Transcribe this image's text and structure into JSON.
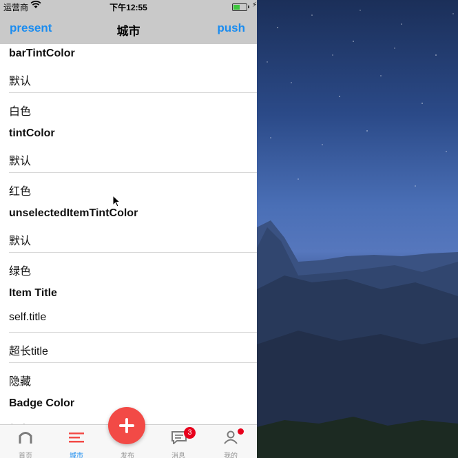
{
  "status_bar": {
    "carrier": "运营商",
    "time": "下午12:55"
  },
  "nav": {
    "left": "present",
    "title": "城市",
    "right": "push"
  },
  "list": {
    "rows": [
      "barTintColor",
      "默认",
      "白色",
      "tintColor",
      "默认",
      "红色",
      "unselectedItemTintColor",
      "默认",
      "绿色",
      "Item Title",
      "self.title",
      "超长title",
      "隐藏",
      "Badge Color",
      "红色"
    ]
  },
  "tabs": [
    {
      "label": "首页",
      "icon": "home-icon"
    },
    {
      "label": "城市",
      "icon": "list-icon",
      "active": true
    },
    {
      "label": "发布",
      "icon": "plus-icon"
    },
    {
      "label": "消息",
      "icon": "message-icon",
      "badge": "3"
    },
    {
      "label": "我的",
      "icon": "person-icon"
    }
  ],
  "colors": {
    "accent": "#1a8cf0",
    "publish": "#f24a46",
    "badge": "#e8001c"
  }
}
